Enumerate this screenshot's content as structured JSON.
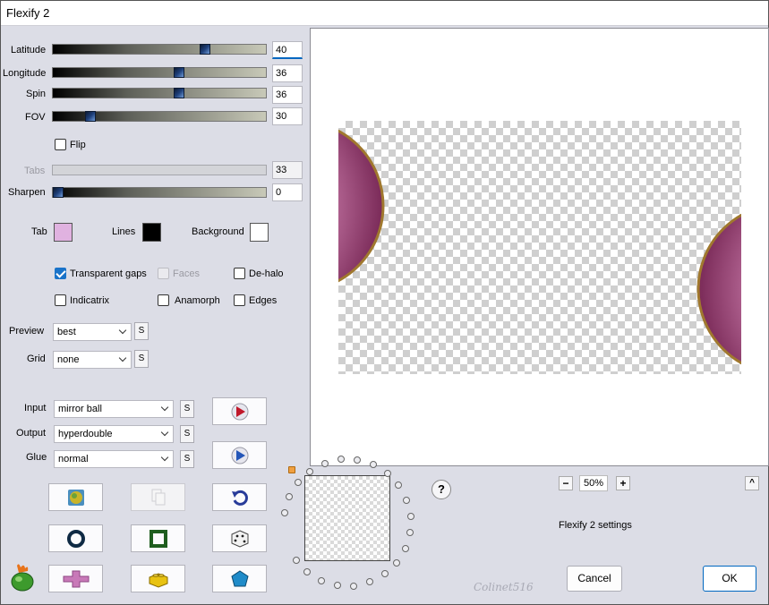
{
  "window": {
    "title": "Flexify 2"
  },
  "sliders": [
    {
      "key": "latitude",
      "label": "Latitude",
      "value": "40",
      "level": 0.714
    },
    {
      "key": "longitude",
      "label": "Longitude",
      "value": "36",
      "level": 0.592
    },
    {
      "key": "spin",
      "label": "Spin",
      "value": "36",
      "level": 0.592
    },
    {
      "key": "fov",
      "label": "FOV",
      "value": "30",
      "level": 0.178
    }
  ],
  "flip": {
    "label": "Flip",
    "checked": false
  },
  "tabs": {
    "label": "Tabs",
    "value": "33",
    "enabled": false
  },
  "sharpen": {
    "label": "Sharpen",
    "value": "0",
    "level": 0.0
  },
  "colors": {
    "tab": {
      "label": "Tab",
      "color": "#e0b2e0"
    },
    "lines": {
      "label": "Lines",
      "color": "#000000"
    },
    "background": {
      "label": "Background",
      "color": "#ffffff"
    }
  },
  "options": {
    "transparent_gaps": {
      "label": "Transparent gaps",
      "checked": true
    },
    "faces": {
      "label": "Faces",
      "checked": false,
      "enabled": false
    },
    "de_halo": {
      "label": "De-halo",
      "checked": false
    },
    "indicatrix": {
      "label": "Indicatrix",
      "checked": false
    },
    "anamorph": {
      "label": "Anamorph",
      "checked": false
    },
    "edges": {
      "label": "Edges",
      "checked": false
    }
  },
  "preview_select": {
    "label": "Preview",
    "value": "best"
  },
  "grid_select": {
    "label": "Grid",
    "value": "none"
  },
  "input_select": {
    "label": "Input",
    "value": "mirror ball"
  },
  "output_select": {
    "label": "Output",
    "value": "hyperdouble"
  },
  "glue_select": {
    "label": "Glue",
    "value": "normal"
  },
  "lock_label": "S",
  "zoom": {
    "value": "50%",
    "minus": "−",
    "plus": "+"
  },
  "help_label": "?",
  "collapse_label": "^",
  "settings_label": "Flexify 2 settings",
  "buttons": {
    "cancel": "Cancel",
    "ok": "OK"
  },
  "signature": "Colinet516"
}
